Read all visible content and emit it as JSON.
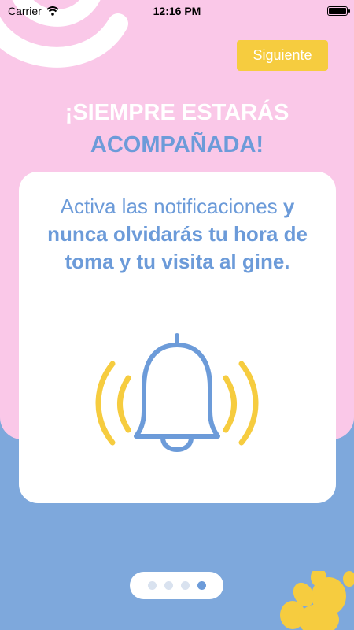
{
  "status_bar": {
    "carrier": "Carrier",
    "time": "12:16 PM",
    "wifi_icon": "wifi-icon",
    "battery_icon": "battery-icon",
    "battery_level": 1.0
  },
  "header": {
    "next_label": "Siguiente"
  },
  "headline": {
    "line1": "¡SIEMPRE ESTARÁS",
    "line2": "ACOMPAÑADA!"
  },
  "card": {
    "text_regular": "Activa las notificaciones ",
    "text_bold": "y nunca olvidarás tu hora de toma y tu visita al gine.",
    "icon": "bell-ringing-icon"
  },
  "pager": {
    "total": 4,
    "active_index": 3
  },
  "colors": {
    "pink": "#FAC8E8",
    "blue": "#7EA8DC",
    "text_blue": "#6C9BD9",
    "yellow": "#F6CC3F"
  }
}
